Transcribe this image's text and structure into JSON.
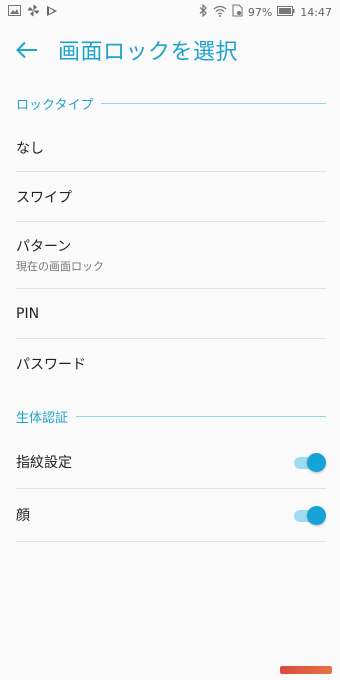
{
  "status_bar": {
    "battery_percent": "97%",
    "time": "14:47",
    "left_icons": [
      "image-icon",
      "pinwheel-icon",
      "app-icon"
    ],
    "right_icons": [
      "bluetooth-icon",
      "wifi-icon",
      "sd-card-icon",
      "battery-icon"
    ]
  },
  "header": {
    "back_icon": "arrow-left-icon",
    "title": "画面ロックを選択"
  },
  "lock_section": {
    "title": "ロックタイプ",
    "items": [
      {
        "label": "なし"
      },
      {
        "label": "スワイプ"
      },
      {
        "label": "パターン",
        "sub": "現在の画面ロック"
      },
      {
        "label": "PIN"
      },
      {
        "label": "パスワード"
      }
    ]
  },
  "bio_section": {
    "title": "生体認証",
    "items": [
      {
        "label": "指紋設定",
        "toggle_on": true
      },
      {
        "label": "顔",
        "toggle_on": true
      }
    ]
  },
  "colors": {
    "accent": "#1fa3cc",
    "toggle_knob": "#16a3d8",
    "toggle_track": "#9fdcf1"
  }
}
